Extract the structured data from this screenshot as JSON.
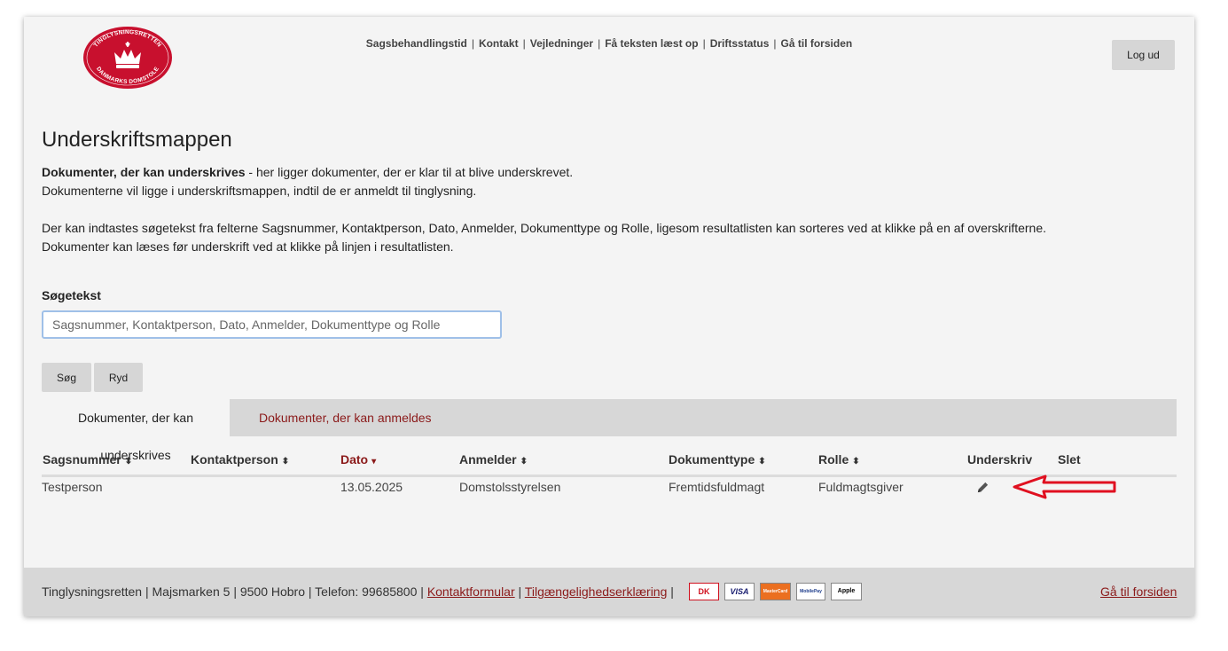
{
  "header": {
    "logo_text_top": "TINGLYSNINGSRETTEN",
    "logo_text_bottom": "DANMARKS DOMSTOLE",
    "nav": [
      "Sagsbehandlingstid",
      "Kontakt",
      "Vejledninger",
      "Få teksten læst op",
      "Driftsstatus",
      "Gå til forsiden"
    ],
    "nav_separator": "|",
    "logout_label": "Log ud"
  },
  "main": {
    "title": "Underskriftsmappen",
    "intro_bold": "Dokumenter, der kan underskrives",
    "intro_rest": " - her ligger dokumenter, der er klar til at blive underskrevet.",
    "intro_line2": "Dokumenterne vil ligge i underskriftsmappen, indtil de er anmeldt til tinglysning.",
    "intro_line3": "Der kan indtastes søgetekst fra felterne Sagsnummer, Kontaktperson, Dato, Anmelder, Dokumenttype og Rolle, ligesom resultatlisten kan sorteres ved at klikke på en af overskrifterne.",
    "intro_line4": "Dokumenter kan læses før underskrift ved at klikke på linjen i resultatlisten."
  },
  "search": {
    "label": "Søgetekst",
    "value": "",
    "placeholder": "Sagsnummer, Kontaktperson, Dato, Anmelder, Dokumenttype og Rolle",
    "search_button": "Søg",
    "clear_button": "Ryd"
  },
  "tabs": [
    {
      "label": "Dokumenter, der kan underskrives",
      "active": true
    },
    {
      "label": "Dokumenter, der kan anmeldes",
      "active": false
    }
  ],
  "table": {
    "columns": [
      "Sagsnummer",
      "Kontaktperson",
      "Dato",
      "Anmelder",
      "Dokumenttype",
      "Rolle",
      "Underskriv",
      "Slet"
    ],
    "sort_icon": "⬍",
    "sorted_icon": "▾",
    "rows": [
      {
        "sagsnummer": "Testperson",
        "kontaktperson": "",
        "dato": "13.05.2025",
        "anmelder": "Domstolsstyrelsen",
        "dokumenttype": "Fremtidsfuldmagt",
        "rolle": "Fuldmagtsgiver",
        "underskriv_icon": "pencil-icon"
      }
    ]
  },
  "footer": {
    "address": "Tinglysningsretten | Majsmarken 5 | 9500 Hobro | Telefon: 99685800 |",
    "contact_link": "Kontaktformular",
    "sep": "|",
    "accessibility_link": "Tilgængelighedserklæring",
    "sep2": "|",
    "payment": [
      "DK",
      "VISA",
      "MasterCard",
      "MobilePay",
      "Apple Pay"
    ],
    "home_link": "Gå til forsiden"
  },
  "colors": {
    "brand_red": "#c8102e",
    "link_red": "#8b1a1a",
    "annotation_arrow": "#e01020"
  }
}
